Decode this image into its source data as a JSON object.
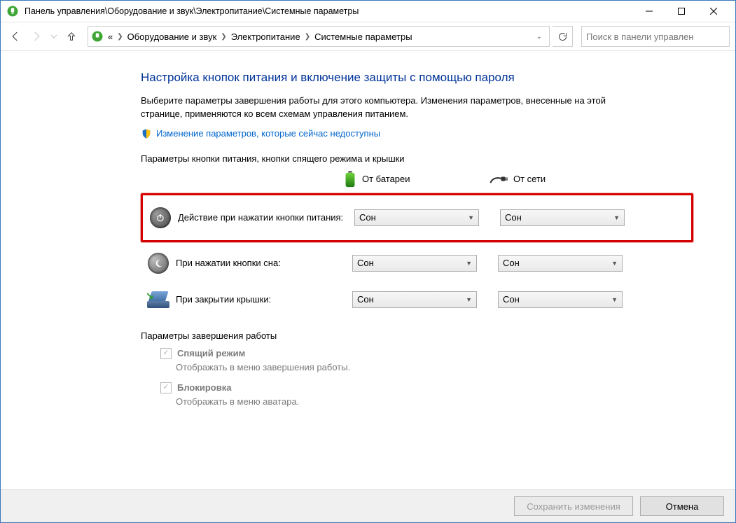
{
  "window": {
    "title": "Панель управления\\Оборудование и звук\\Электропитание\\Системные параметры"
  },
  "breadcrumb": {
    "ellipsis": "«",
    "segments": [
      "Оборудование и звук",
      "Электропитание",
      "Системные параметры"
    ]
  },
  "search": {
    "placeholder": "Поиск в панели управлен"
  },
  "page": {
    "heading": "Настройка кнопок питания и включение защиты с помощью пароля",
    "description": "Выберите параметры завершения работы для этого компьютера. Изменения параметров, внесенные на этой странице, применяются ко всем схемам управления питанием.",
    "admin_link": "Изменение параметров, которые сейчас недоступны",
    "section1": "Параметры кнопки питания, кнопки спящего режима и крышки",
    "col_battery": "От батареи",
    "col_ac": "От сети",
    "rows": [
      {
        "label": "Действие при нажатии кнопки питания:",
        "battery": "Сон",
        "ac": "Сон"
      },
      {
        "label": "При нажатии кнопки сна:",
        "battery": "Сон",
        "ac": "Сон"
      },
      {
        "label": "При закрытии крышки:",
        "battery": "Сон",
        "ac": "Сон"
      }
    ],
    "section2": "Параметры завершения работы",
    "shutdown": [
      {
        "label": "Спящий режим",
        "desc": "Отображать в меню завершения работы."
      },
      {
        "label": "Блокировка",
        "desc": "Отображать в меню аватара."
      }
    ]
  },
  "footer": {
    "save": "Сохранить изменения",
    "cancel": "Отмена"
  }
}
